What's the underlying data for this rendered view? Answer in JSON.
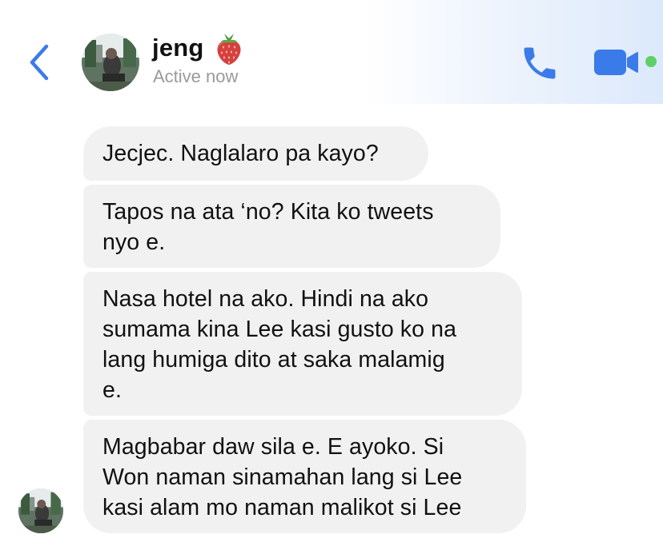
{
  "header": {
    "contact_name": "jeng",
    "name_emoji": "strawberry-emoji",
    "status": "Active now",
    "icons": {
      "back": "chevron-left-icon",
      "call": "phone-icon",
      "video": "video-camera-icon"
    },
    "accent_color": "#3b7be9",
    "online_color": "#5fd068"
  },
  "conversation": {
    "sender": "jeng",
    "messages": [
      {
        "lines": [
          "Jecjec. Naglalaro pa kayo?"
        ]
      },
      {
        "lines": [
          "Tapos na ata ‘no? Kita ko tweets",
          "nyo e."
        ]
      },
      {
        "lines": [
          "Nasa hotel na ako. Hindi na ako",
          "sumama kina Lee kasi gusto ko na",
          "lang humiga dito at saka malamig",
          "e."
        ]
      },
      {
        "lines": [
          "Magbabar daw sila e. E ayoko. Si",
          "Won naman sinamahan lang si Lee",
          "kasi alam mo naman malikot si Lee"
        ]
      }
    ],
    "bubble_color": "#f1f1f2"
  }
}
